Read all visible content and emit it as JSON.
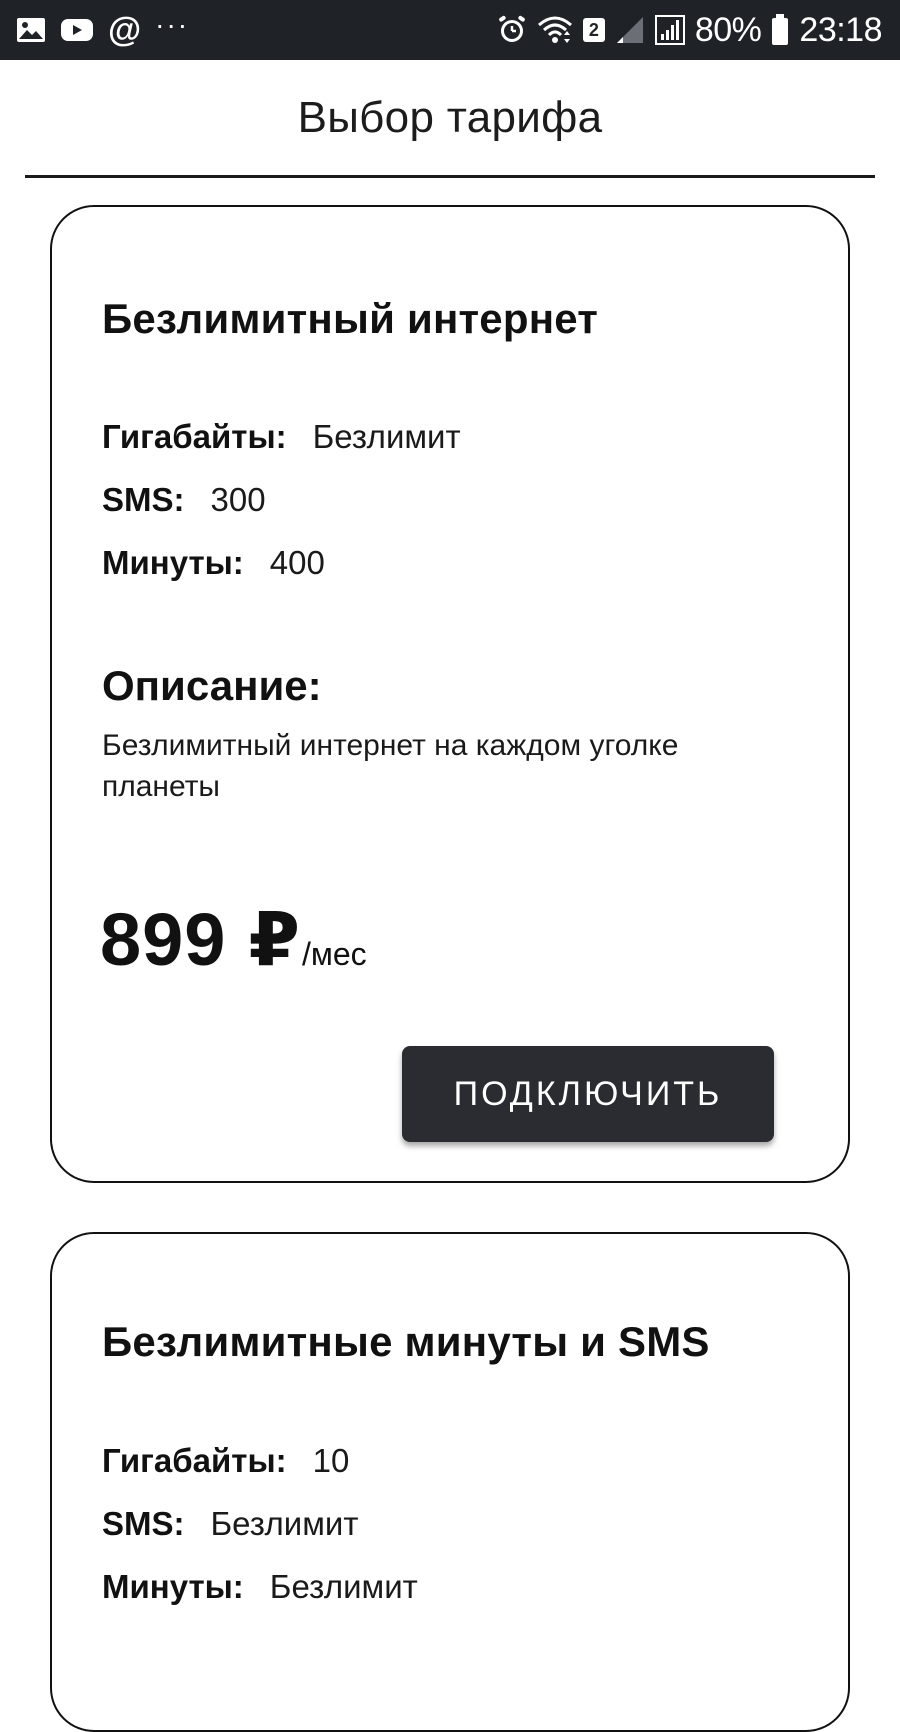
{
  "status_bar": {
    "left_icons": [
      "image-icon",
      "youtube-icon",
      "at-icon",
      "more-icon"
    ],
    "at_symbol": "@",
    "more_symbol": "···",
    "sim_number": "2",
    "battery_percent": "80%",
    "time": "23:18"
  },
  "header": {
    "title": "Выбор тарифа"
  },
  "tariffs": [
    {
      "title": "Безлимитный интернет",
      "specs": [
        {
          "label": "Гигабайты:",
          "value": "Безлимит"
        },
        {
          "label": "SMS:",
          "value": "300"
        },
        {
          "label": "Минуты:",
          "value": "400"
        }
      ],
      "description_heading": "Описание:",
      "description": "Безлимитный интернет на каждом уголке планеты",
      "price": "899",
      "currency": "₽",
      "period": "/мес",
      "button_label": "ПОДКЛЮЧИТЬ"
    },
    {
      "title": "Безлимитные минуты и SMS",
      "specs": [
        {
          "label": "Гигабайты:",
          "value": "10"
        },
        {
          "label": "SMS:",
          "value": "Безлимит"
        },
        {
          "label": "Минуты:",
          "value": "Безлимит"
        }
      ]
    }
  ]
}
